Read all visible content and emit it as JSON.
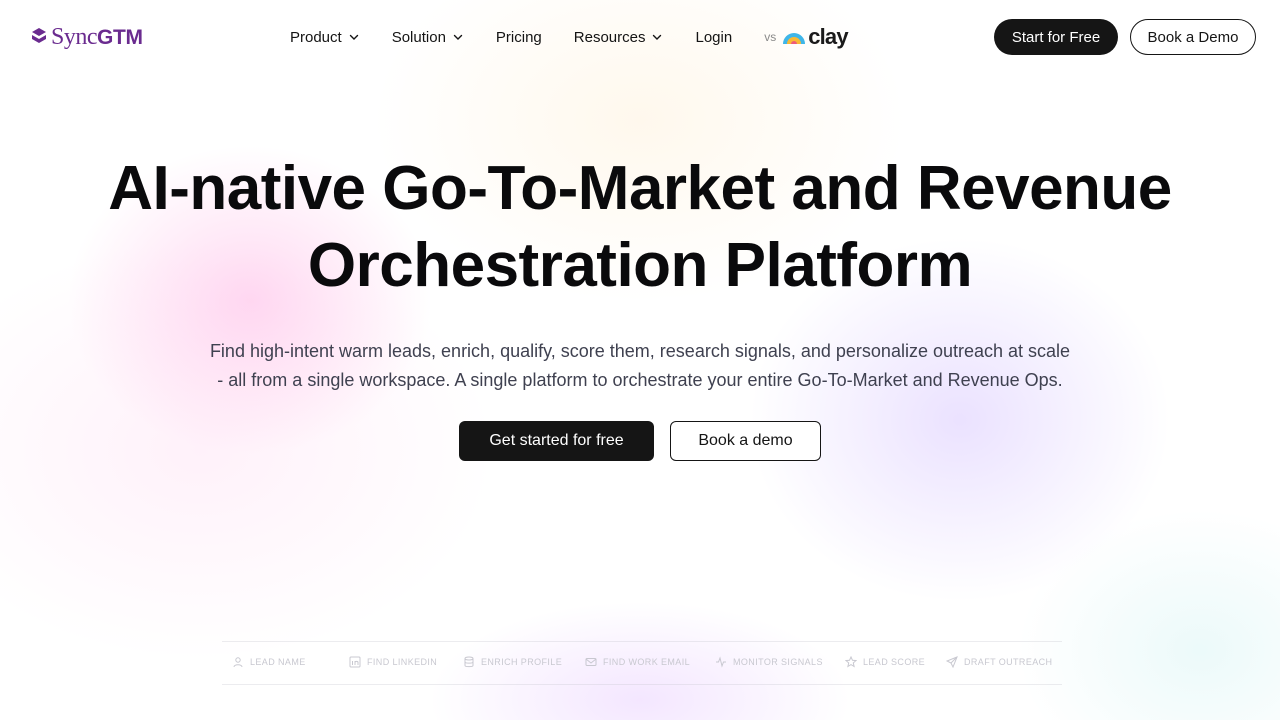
{
  "brand": {
    "logo_word": "Sync",
    "logo_bold": "GTM"
  },
  "nav": {
    "items": [
      {
        "label": "Product",
        "dropdown": true
      },
      {
        "label": "Solution",
        "dropdown": true
      },
      {
        "label": "Pricing",
        "dropdown": false
      },
      {
        "label": "Resources",
        "dropdown": true
      },
      {
        "label": "Login",
        "dropdown": false
      }
    ],
    "vs_label": "vs",
    "competitor": "clay",
    "start_label": "Start for Free",
    "demo_label": "Book a Demo"
  },
  "hero": {
    "title_line1": "AI-native Go-To-Market and Revenue",
    "title_line2": "Orchestration Platform",
    "subtitle_line1": "Find high-intent warm leads, enrich, qualify, score them, research signals, and personalize outreach at scale",
    "subtitle_line2": "- all from a single workspace. A single platform to orchestrate your entire Go-To-Market and Revenue Ops.",
    "cta_primary": "Get started for free",
    "cta_secondary": "Book a demo"
  },
  "workflow": {
    "steps": [
      {
        "label": "Lead Name",
        "icon": "user-icon"
      },
      {
        "label": "Find LinkedIn",
        "icon": "linkedin-icon"
      },
      {
        "label": "Enrich Profile",
        "icon": "database-icon"
      },
      {
        "label": "Find Work Email",
        "icon": "mail-icon"
      },
      {
        "label": "Monitor Signals",
        "icon": "activity-icon"
      },
      {
        "label": "Lead Score",
        "icon": "star-icon"
      },
      {
        "label": "Draft Outreach",
        "icon": "send-icon"
      }
    ]
  },
  "colors": {
    "brand_purple": "#6a2b8f",
    "button_dark": "#151515"
  }
}
